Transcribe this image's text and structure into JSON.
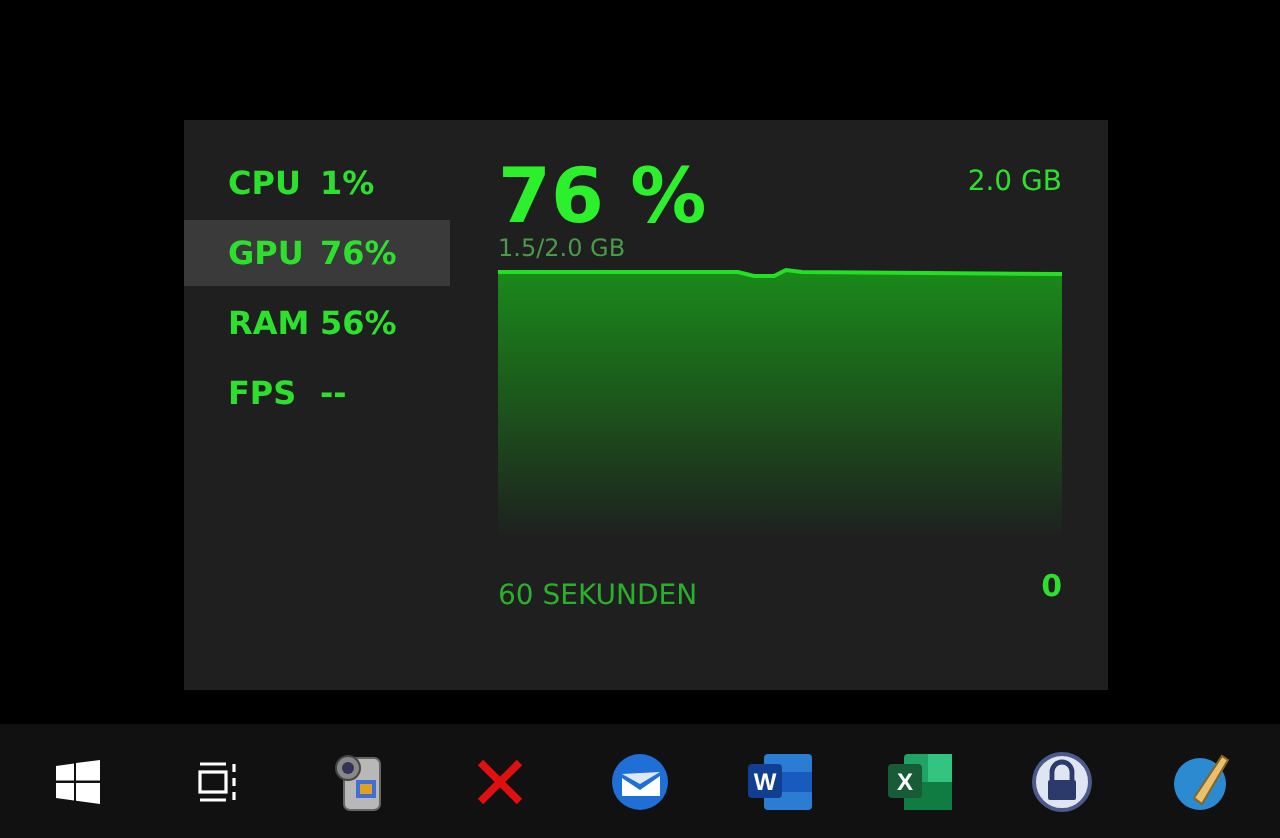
{
  "metrics": [
    {
      "name": "CPU",
      "value": "1%",
      "selected": false
    },
    {
      "name": "GPU",
      "value": "76%",
      "selected": true
    },
    {
      "name": "RAM",
      "value": "56%",
      "selected": false
    },
    {
      "name": "FPS",
      "value": "--",
      "selected": false
    }
  ],
  "detail": {
    "big_value": "76 %",
    "max_label": "2.0 GB",
    "usage_label": "1.5/2.0 GB",
    "time_label": "60 SEKUNDEN",
    "min_label": "0"
  },
  "taskbar": [
    {
      "kind": "start"
    },
    {
      "kind": "taskview"
    },
    {
      "kind": "camcorder"
    },
    {
      "kind": "cross"
    },
    {
      "kind": "mail"
    },
    {
      "kind": "word",
      "letter": "W"
    },
    {
      "kind": "excel",
      "letter": "X"
    },
    {
      "kind": "lock"
    },
    {
      "kind": "pen"
    }
  ]
}
